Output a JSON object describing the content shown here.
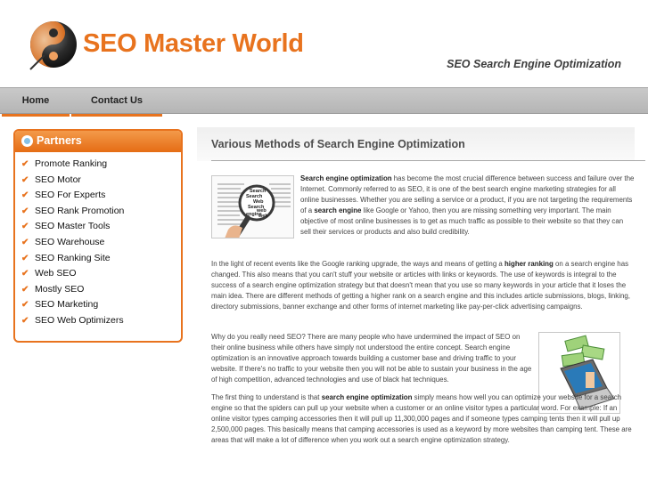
{
  "header": {
    "site_title": "SEO Master World",
    "tagline": "SEO Search Engine Optimization"
  },
  "nav": {
    "items": [
      {
        "label": "Home"
      },
      {
        "label": "Contact Us"
      }
    ]
  },
  "sidebar": {
    "heading": "Partners",
    "items": [
      {
        "label": "Promote Ranking"
      },
      {
        "label": "SEO Motor"
      },
      {
        "label": "SEO For Experts"
      },
      {
        "label": "SEO Rank Promotion"
      },
      {
        "label": "SEO Master Tools"
      },
      {
        "label": "SEO Warehouse"
      },
      {
        "label": "SEO Ranking Site"
      },
      {
        "label": "Web SEO"
      },
      {
        "label": "Mostly SEO"
      },
      {
        "label": "SEO Marketing"
      },
      {
        "label": "SEO Web Optimizers"
      }
    ]
  },
  "main": {
    "title": "Various Methods of Search Engine Optimization",
    "p1": {
      "b1": "Search engine optimization",
      "t1": " has become the most crucial difference between success and failure over the Internet. Commonly referred to as SEO, it is one of the best search engine marketing strategies for all online businesses. Whether you are selling a service or a product, if you are not targeting the requirements of a ",
      "b2": "search engine",
      "t2": " like Google or Yahoo, then you are missing something very important. The main objective of most online businesses is to get as much traffic as possible to their website so that they can sell their services or products and also build credibility."
    },
    "p2": {
      "t1": "In the light of recent events like the Google ranking upgrade, the ways and means of getting a ",
      "b1": "higher ranking",
      "t2": " on a search engine has changed. This also means that you can't stuff your website or articles with links or keywords. The use of keywords is integral to the success of a search engine optimization strategy but that doesn't mean that you use so many keywords in your article that it loses the main idea. There are different methods of getting a higher rank on a search engine and this includes article submissions, blogs, linking, directory submissions, banner exchange and other forms of internet marketing like pay-per-click advertising campaigns."
    },
    "p3": "Why do you really need SEO? There are many people who have undermined the impact of SEO on their online business while others have simply not understood the entire concept. Search engine optimization is an innovative approach towards building a customer base and driving traffic to your website. If there's no traffic to your website then you will not be able to sustain your business in the age of high competition, advanced technologies and use of black hat techniques.",
    "p4": {
      "t1": "The first thing to understand is that ",
      "b1": "search engine optimization",
      "t2": " simply means how well you can optimize your website for a search engine so that the spiders can pull up your website when a customer or an online visitor types a particular word. For example: If an online visitor types camping accessories then it will pull up 11,300,000 pages and if someone types camping tents then it will pull up 2,500,000 pages. This basically means that camping accessories is used as a keyword by more websites than camping tent. These are areas that will make a lot of difference when you work out a search engine optimization strategy."
    },
    "img_seo_words": [
      "Search",
      "Search",
      "Web",
      "Search",
      "web",
      "engine",
      "web"
    ]
  },
  "colors": {
    "accent": "#e8731e",
    "nav_bg": "#c0c0c0",
    "title_text": "#4d4d4d"
  },
  "icons": {
    "logo": "yin-yang-globe-icon",
    "partners": "bullet-circle-icon",
    "partner_bullet": "checkmark-icon"
  }
}
